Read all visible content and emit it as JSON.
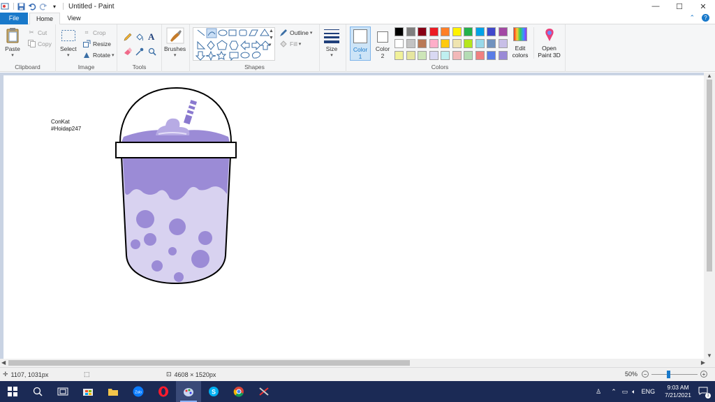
{
  "window": {
    "title": "Untitled - Paint",
    "controls": {
      "minimize": "—",
      "maximize": "☐",
      "close": "✕"
    }
  },
  "tabs": {
    "file": "File",
    "home": "Home",
    "view": "View"
  },
  "ribbon": {
    "clipboard": {
      "label": "Clipboard",
      "paste": "Paste",
      "cut": "Cut",
      "copy": "Copy"
    },
    "image": {
      "label": "Image",
      "select": "Select",
      "crop": "Crop",
      "resize": "Resize",
      "rotate": "Rotate"
    },
    "tools": {
      "label": "Tools"
    },
    "brushes": {
      "label": "Brushes"
    },
    "shapes": {
      "label": "Shapes",
      "outline": "Outline",
      "fill": "Fill"
    },
    "size": {
      "label": "Size"
    },
    "colors": {
      "label": "Colors",
      "color1": "Color\n1",
      "color1_line1": "Color",
      "color1_line2": "1",
      "color2_line1": "Color",
      "color2_line2": "2",
      "edit_line1": "Edit",
      "edit_line2": "colors",
      "paint3d_line1": "Open",
      "paint3d_line2": "Paint 3D",
      "row1": [
        "#000000",
        "#7f7f7f",
        "#880015",
        "#ed1c24",
        "#ff7f27",
        "#fff200",
        "#22b14c",
        "#00a2e8",
        "#3f48cc",
        "#a349a4"
      ],
      "row2": [
        "#ffffff",
        "#c3c3c3",
        "#b97a57",
        "#ffaec9",
        "#ffc90e",
        "#efe4b0",
        "#b5e61d",
        "#99d9ea",
        "#7092be",
        "#c8bfe7"
      ],
      "row3": [
        "#f1f19a",
        "#e6e6a0",
        "#cde6b8",
        "#d9d9f3",
        "#bfeff0",
        "#f2b8b8",
        "#b4dcb4",
        "#f08080",
        "#5a7de6",
        "#9a8ad6"
      ]
    }
  },
  "canvas": {
    "text_line1": "ConKat",
    "text_line2": "#Hoidap247",
    "drawing_colors": {
      "cup_fill": "#d8d2f0",
      "drink": "#9b8bd6",
      "bubbles": "#9b8bd6",
      "lid": "#ffffff"
    }
  },
  "status": {
    "cursor": "1107, 1031px",
    "size": "4608 × 1520px",
    "zoom": "50%"
  },
  "taskbar": {
    "lang": "ENG",
    "time": "9:03 AM",
    "date": "7/21/2021",
    "notification_count": "1"
  }
}
